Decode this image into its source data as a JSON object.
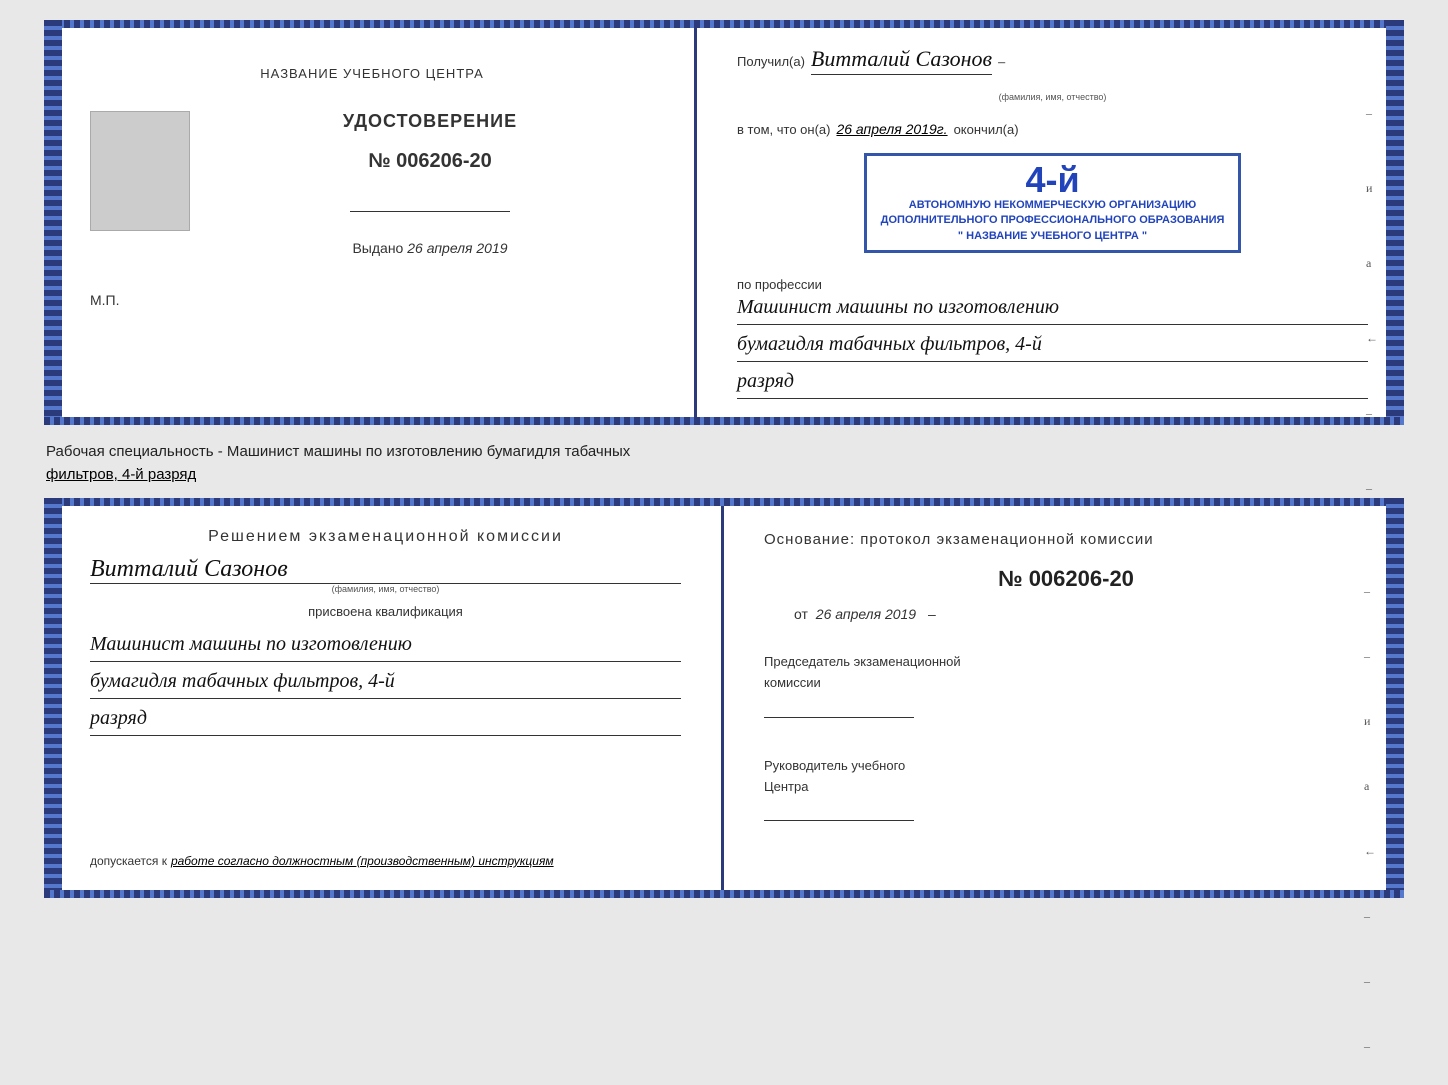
{
  "diploma": {
    "left": {
      "center_title": "НАЗВАНИЕ УЧЕБНОГО ЦЕНТРА",
      "udostoverenie_label": "УДОСТОВЕРЕНИЕ",
      "number": "№ 006206-20",
      "vydano_label": "Выдано",
      "vydano_date": "26 апреля 2019",
      "mp_label": "М.П."
    },
    "right": {
      "poluchil_label": "Получил(а)",
      "name_handwritten": "Витталий Сазонов",
      "name_sublabel": "(фамилия, имя, отчество)",
      "dash": "–",
      "vtom_label": "в том, что он(а)",
      "date_handwritten": "26 апреля 2019г.",
      "okonchil_label": "окончил(а)",
      "stamp_number": "4-й",
      "stamp_line1": "АВТОНОМНУЮ НЕКОММЕРЧЕСКУЮ ОРГАНИЗАЦИЮ",
      "stamp_line2": "ДОПОЛНИТЕЛЬНОГО ПРОФЕССИОНАЛЬНОГО ОБРАЗОВАНИЯ",
      "stamp_line3": "\" НАЗВАНИЕ УЧЕБНОГО ЦЕНТРА \"",
      "i_label": "и",
      "a_label": "а",
      "arrow_label": "←",
      "po_professii": "по профессии",
      "profession_line1": "Машинист машины по изготовлению",
      "profession_line2": "бумагидля табачных фильтров, 4-й",
      "profession_line3": "разряд"
    }
  },
  "specialty_label": "Рабочая специальность - Машинист машины по изготовлению бумагидля табачных",
  "specialty_underline": "фильтров, 4-й разряд",
  "bottom": {
    "left": {
      "resheniem_title": "Решением  экзаменационной  комиссии",
      "name_handwritten": "Витталий Сазонов",
      "name_sublabel": "(фамилия, имя, отчество)",
      "prisvoena": "присвоена квалификация",
      "qual_line1": "Машинист машины по изготовлению",
      "qual_line2": "бумагидля табачных фильтров, 4-й",
      "qual_line3": "разряд",
      "dopuskaetsya_label": "допускается к",
      "dopusk_text": "работе согласно должностным (производственным) инструкциям"
    },
    "right": {
      "osnovanie_text": "Основание: протокол экзаменационной  комиссии",
      "number": "№  006206-20",
      "ot_label": "от",
      "ot_date": "26 апреля 2019",
      "predsedatel_line1": "Председатель экзаменационной",
      "predsedatel_line2": "комиссии",
      "rukovoditel_line1": "Руководитель учебного",
      "rukovoditel_line2": "Центра",
      "i_label": "и",
      "a_label": "а",
      "arrow_label": "←"
    }
  }
}
